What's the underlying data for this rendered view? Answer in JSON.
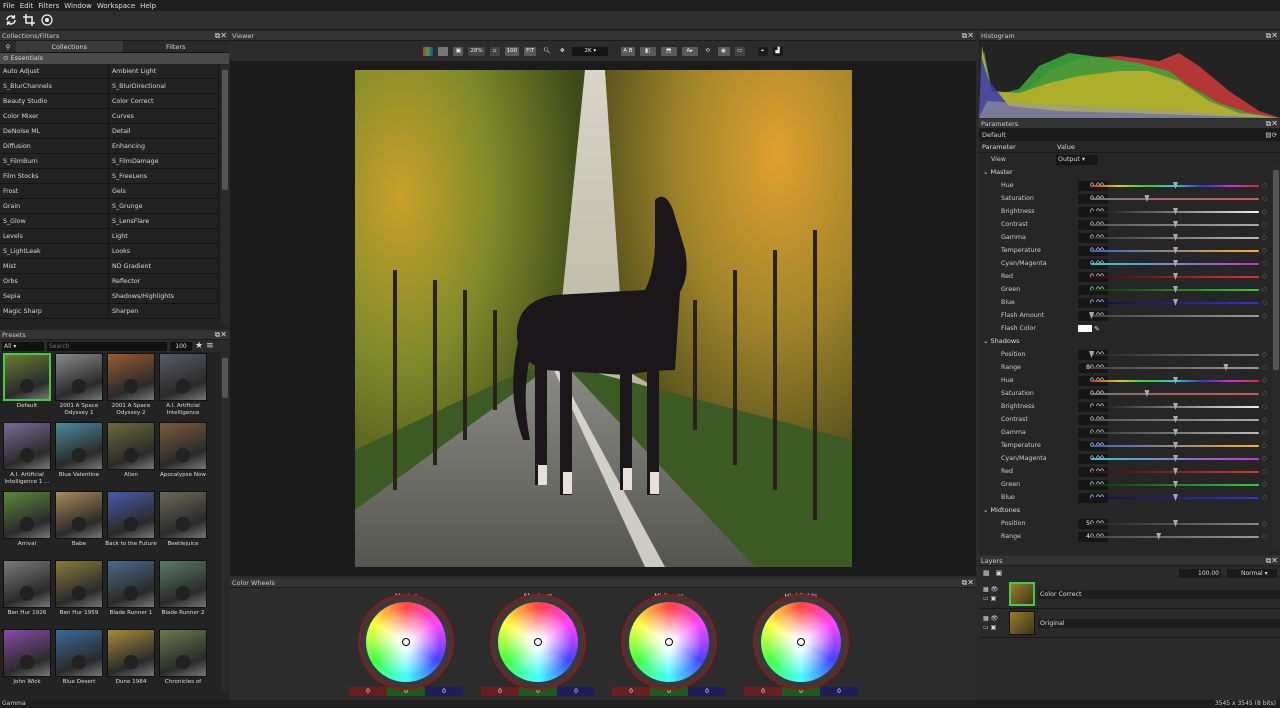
{
  "menu": [
    "File",
    "Edit",
    "Filters",
    "Window",
    "Workspace",
    "Help"
  ],
  "panels": {
    "collections": "Collections/Filters",
    "viewer": "Viewer",
    "histogram": "Histogram",
    "parameters": "Parameters",
    "presets": "Presets",
    "layers": "Layers",
    "color_wheels": "Color Wheels"
  },
  "coll_tabs": [
    "Collections",
    "Filters"
  ],
  "essentials": "Essentials",
  "filters": [
    "Auto Adjust",
    "Ambient Light",
    "S_BlurChannels",
    "S_BlurDirectional",
    "Beauty Studio",
    "Color Correct",
    "Color Mixer",
    "Curves",
    "DeNoise ML",
    "Detail",
    "Diffusion",
    "Enhancing",
    "S_FilmBurn",
    "S_FilmDamage",
    "Film Stocks",
    "S_FreeLens",
    "Frost",
    "Gels",
    "Grain",
    "S_Grunge",
    "S_Glow",
    "S_LensFlare",
    "Levels",
    "Light",
    "S_LightLeak",
    "Looks",
    "Mist",
    "ND Gradient",
    "Orbs",
    "Reflector",
    "Sepia",
    "Shadows/Highlights",
    "Magic Sharp",
    "Sharpen"
  ],
  "preset_filter": {
    "category": "All",
    "search_placeholder": "Search",
    "size": "100"
  },
  "presets": [
    {
      "name": "Default",
      "tint": "#6a7a30"
    },
    {
      "name": "2001 A Space Odyssey 1",
      "tint": "#8a8a8a"
    },
    {
      "name": "2001 A Space Odyssey 2",
      "tint": "#9a5a30"
    },
    {
      "name": "A.I. Artificial Intelligence",
      "tint": "#5a5a6a"
    },
    {
      "name": "A.I. Artificial Intelligence 1 ...",
      "tint": "#7a6a9a"
    },
    {
      "name": "Blue Valentine",
      "tint": "#4a8aa0"
    },
    {
      "name": "Alien",
      "tint": "#6a6a3a"
    },
    {
      "name": "Apocalypse Now",
      "tint": "#7a5a3a"
    },
    {
      "name": "Arrival",
      "tint": "#5a8a3a"
    },
    {
      "name": "Babe",
      "tint": "#aa8a5a"
    },
    {
      "name": "Back to the Future",
      "tint": "#4a5aaa"
    },
    {
      "name": "Beetlejuice",
      "tint": "#6a6a5a"
    },
    {
      "name": "Ben Hur 1926",
      "tint": "#7a7a7a"
    },
    {
      "name": "Ben Hur 1959",
      "tint": "#8a7a3a"
    },
    {
      "name": "Blade Runner 1",
      "tint": "#4a6a8a"
    },
    {
      "name": "Blade Runner 2",
      "tint": "#5a7a6a"
    },
    {
      "name": "John Wick",
      "tint": "#8a4aaa"
    },
    {
      "name": "Blue Desert",
      "tint": "#3a6a9a"
    },
    {
      "name": "Dune 1984",
      "tint": "#aa8a3a"
    },
    {
      "name": "Chronicles of",
      "tint": "#6a7a4a"
    }
  ],
  "viewer_tools": {
    "zoom": "28%",
    "hundred": "100",
    "fit": "FIT",
    "res": "2K",
    "ab": "A B"
  },
  "wheels": [
    {
      "label": "Master",
      "values": [
        "0",
        "0",
        "0"
      ]
    },
    {
      "label": "Shadows",
      "values": [
        "0",
        "0",
        "0"
      ]
    },
    {
      "label": "Midtones",
      "values": [
        "0",
        "0",
        "0"
      ]
    },
    {
      "label": "Highlights",
      "values": [
        "0",
        "0",
        "0"
      ]
    }
  ],
  "params_header": {
    "preset": "Default",
    "col_param": "Parameter",
    "col_value": "Value",
    "view_label": "View",
    "view_value": "Output"
  },
  "master": [
    {
      "name": "Hue",
      "value": "0.00",
      "pos": 0.5,
      "grad": "linear-gradient(90deg,#c33,#cc3,#3c3,#3cc,#33c,#c3c,#c33)"
    },
    {
      "name": "Saturation",
      "value": "0.00",
      "pos": 0.33,
      "grad": "linear-gradient(90deg,#777,#c55)"
    },
    {
      "name": "Brightness",
      "value": "0.00",
      "pos": 0.5,
      "grad": "linear-gradient(90deg,#111,#eee)"
    },
    {
      "name": "Contrast",
      "value": "0.00",
      "pos": 0.5,
      "grad": "linear-gradient(90deg,#555,#aaa)"
    },
    {
      "name": "Gamma",
      "value": "0.00",
      "pos": 0.5,
      "grad": "linear-gradient(90deg,#333,#bbb)"
    },
    {
      "name": "Temperature",
      "value": "0.00",
      "pos": 0.5,
      "grad": "linear-gradient(90deg,#36c,#fa3)"
    },
    {
      "name": "Cyan/Magenta",
      "value": "0.00",
      "pos": 0.5,
      "grad": "linear-gradient(90deg,#3cc,#c3c)"
    },
    {
      "name": "Red",
      "value": "0.00",
      "pos": 0.5,
      "grad": "linear-gradient(90deg,#311,#d33)"
    },
    {
      "name": "Green",
      "value": "0.00",
      "pos": 0.5,
      "grad": "linear-gradient(90deg,#131,#3c3)"
    },
    {
      "name": "Blue",
      "value": "0.00",
      "pos": 0.5,
      "grad": "linear-gradient(90deg,#113,#33d)"
    },
    {
      "name": "Flash Amount",
      "value": "0.00",
      "pos": 0.0,
      "grad": "linear-gradient(90deg,#444,#999)"
    }
  ],
  "flash_color_label": "Flash Color",
  "sections": {
    "master": "Master",
    "shadows": "Shadows",
    "midtones": "Midtones"
  },
  "shadows": [
    {
      "name": "Position",
      "value": "0.00",
      "pos": 0.0,
      "grad": "linear-gradient(90deg,#222,#888)"
    },
    {
      "name": "Range",
      "value": "80.00",
      "pos": 0.8,
      "grad": "linear-gradient(90deg,#444,#999)"
    },
    {
      "name": "Hue",
      "value": "0.00",
      "pos": 0.5,
      "grad": "linear-gradient(90deg,#c33,#cc3,#3c3,#3cc,#33c,#c3c,#c33)"
    },
    {
      "name": "Saturation",
      "value": "0.00",
      "pos": 0.33,
      "grad": "linear-gradient(90deg,#777,#c55)"
    },
    {
      "name": "Brightness",
      "value": "0.00",
      "pos": 0.5,
      "grad": "linear-gradient(90deg,#111,#eee)"
    },
    {
      "name": "Contrast",
      "value": "0.00",
      "pos": 0.5,
      "grad": "linear-gradient(90deg,#555,#aaa)"
    },
    {
      "name": "Gamma",
      "value": "0.00",
      "pos": 0.5,
      "grad": "linear-gradient(90deg,#333,#bbb)"
    },
    {
      "name": "Temperature",
      "value": "0.00",
      "pos": 0.5,
      "grad": "linear-gradient(90deg,#36c,#fa3)"
    },
    {
      "name": "Cyan/Magenta",
      "value": "0.00",
      "pos": 0.5,
      "grad": "linear-gradient(90deg,#3cc,#c3c)"
    },
    {
      "name": "Red",
      "value": "0.00",
      "pos": 0.5,
      "grad": "linear-gradient(90deg,#311,#d33)"
    },
    {
      "name": "Green",
      "value": "0.00",
      "pos": 0.5,
      "grad": "linear-gradient(90deg,#131,#3c3)"
    },
    {
      "name": "Blue",
      "value": "0.00",
      "pos": 0.5,
      "grad": "linear-gradient(90deg,#113,#33d)"
    }
  ],
  "midtones": [
    {
      "name": "Position",
      "value": "50.00",
      "pos": 0.5,
      "grad": "linear-gradient(90deg,#222,#888)"
    },
    {
      "name": "Range",
      "value": "40.00",
      "pos": 0.4,
      "grad": "linear-gradient(90deg,#444,#999)"
    }
  ],
  "layers": {
    "opacity": "100.00",
    "blend": "Normal",
    "items": [
      "Color Correct",
      "Original"
    ]
  },
  "status": {
    "left": "Gamma",
    "right": "3545 x 3545 (8 bits)"
  }
}
